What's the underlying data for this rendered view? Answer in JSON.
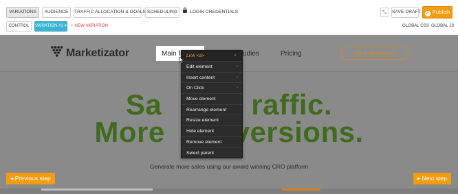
{
  "toolbar": {
    "tabs": [
      {
        "label": "VARIATIONS",
        "active": true
      },
      {
        "label": "AUDIENCE",
        "active": false
      },
      {
        "label": "TRAFFIC ALLOCATION & GOALS",
        "active": false
      },
      {
        "label": "SCHEDULING",
        "active": false
      },
      {
        "label": "LOGIN CREDENTIALS",
        "active": false
      }
    ],
    "control_label": "CONTROL",
    "variation_label": "VARIATION #1 ▾",
    "new_variation_label": "+ NEW VARIATION",
    "save_draft_label": "SAVE DRAFT",
    "publish_label": "Publish",
    "global_css_label": "GLOBAL CSS",
    "global_js_label": "GLOBAL JS",
    "expand_icon": "expand-icon",
    "lock_icon": "lock-icon"
  },
  "site": {
    "logo_text": "Marketizator",
    "nav": {
      "selected_item": "Main fe",
      "case_studies": "udies",
      "pricing": "Pricing",
      "dashboard_button": "Go to dashboard"
    },
    "hero_line1_left": "Sa",
    "hero_line1_right": "raffic.",
    "hero_line2_left": "More",
    "hero_line2_right": "versions.",
    "tagline": "Generate more sales using our award winning CRO platform"
  },
  "steps": {
    "previous": "◂ Previous step",
    "next": "▸ Next step"
  },
  "context_menu": {
    "header": "Link <a>",
    "close": "×",
    "items": [
      {
        "label": "Edit element",
        "has_submenu": true
      },
      {
        "label": "Insert content",
        "has_submenu": true
      },
      {
        "label": "On Click",
        "has_submenu": true
      },
      {
        "label": "Move element",
        "has_submenu": false
      },
      {
        "label": "Rearrange element",
        "has_submenu": false
      },
      {
        "label": "Resize element",
        "has_submenu": false
      },
      {
        "label": "Hide element",
        "has_submenu": false
      },
      {
        "label": "Remove element",
        "has_submenu": false
      },
      {
        "label": "Select parent",
        "has_submenu": false
      }
    ],
    "submenu_arrow": "›"
  },
  "colors": {
    "accent_orange": "#f39c12",
    "variation_blue": "#3cb4d2",
    "hero_green": "#3f6b1e",
    "menu_bg": "#2c2c2c"
  }
}
